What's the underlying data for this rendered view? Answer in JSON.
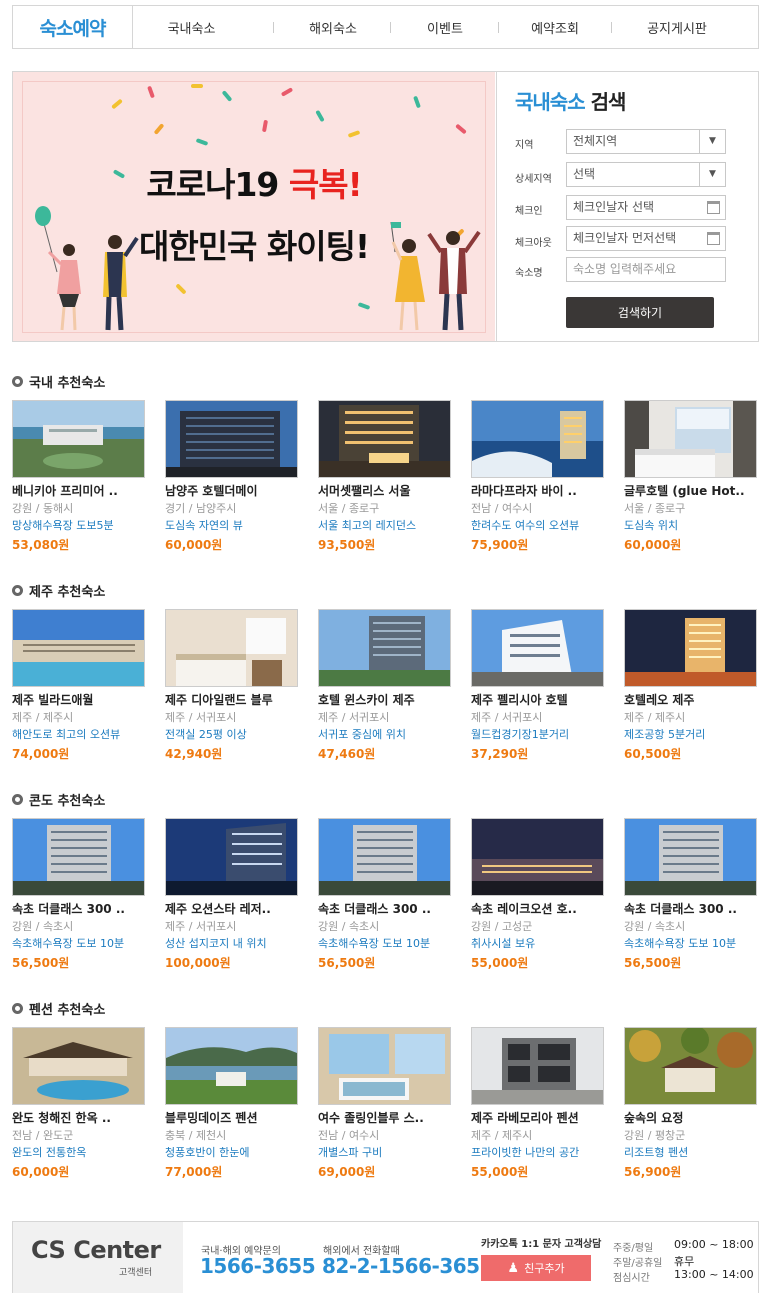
{
  "header": {
    "logo": "숙소예약",
    "nav": [
      "국내숙소",
      "해외숙소",
      "이벤트",
      "예약조회",
      "공지게시판"
    ]
  },
  "banner": {
    "line1_pre": "코로나19 ",
    "line1_highlight": "극복!",
    "line2": "대한민국 화이팅!"
  },
  "search": {
    "title_highlight": "국내숙소",
    "title_rest": " 검색",
    "fields": [
      {
        "label": "지역",
        "value": "전체지역"
      },
      {
        "label": "상세지역",
        "value": "선택"
      },
      {
        "label": "체크인",
        "value": "체크인날자 선택"
      },
      {
        "label": "체크아웃",
        "value": "체크인날자 먼저선택"
      },
      {
        "label": "숙소명",
        "placeholder": "숙소명 입력해주세요"
      }
    ],
    "button": "검색하기"
  },
  "sections": [
    {
      "title": "국내 추천숙소",
      "items": [
        {
          "name": "베니키아 프리미어 ..",
          "location": "강원 / 동해시",
          "desc": "망상해수욕장 도보5분",
          "price": "53,080원"
        },
        {
          "name": "남양주 호텔더메이",
          "location": "경기 / 남양주시",
          "desc": "도심속 자연의 뷰",
          "price": "60,000원"
        },
        {
          "name": "서머셋팰리스 서울",
          "location": "서울 / 종로구",
          "desc": "서울 최고의 레지던스",
          "price": "93,500원"
        },
        {
          "name": "라마다프라자 바이 ..",
          "location": "전남 / 여수시",
          "desc": "한려수도 여수의 오션뷰",
          "price": "75,900원"
        },
        {
          "name": "글루호텔 (glue Hot..",
          "location": "서울 / 종로구",
          "desc": "도심속 위치",
          "price": "60,000원"
        }
      ]
    },
    {
      "title": "제주 추천숙소",
      "items": [
        {
          "name": "제주 빌라드애월",
          "location": "제주 / 제주시",
          "desc": "해안도로 최고의 오션뷰",
          "price": "74,000원"
        },
        {
          "name": "제주 디아일랜드 블루",
          "location": "제주 / 서귀포시",
          "desc": "전객실 25평 이상",
          "price": "42,940원"
        },
        {
          "name": "호텔 윈스카이 제주",
          "location": "제주 / 서귀포시",
          "desc": "서귀포 중심에 위치",
          "price": "47,460원"
        },
        {
          "name": "제주 펠리시아 호텔",
          "location": "제주 / 서귀포시",
          "desc": "월드컵경기장1분거리",
          "price": "37,290원"
        },
        {
          "name": "호텔레오 제주",
          "location": "제주 / 제주시",
          "desc": "제조공항 5분거리",
          "price": "60,500원"
        }
      ]
    },
    {
      "title": "콘도 추천숙소",
      "items": [
        {
          "name": "속초 더클래스 300 ..",
          "location": "강원 / 속초시",
          "desc": "속초해수욕장 도보 10분",
          "price": "56,500원"
        },
        {
          "name": "제주 오션스타 레저..",
          "location": "제주 / 서귀포시",
          "desc": "성산 섭지코지 내 위치",
          "price": "100,000원"
        },
        {
          "name": "속초 더클래스 300 ..",
          "location": "강원 / 속초시",
          "desc": "속초해수욕장 도보 10분",
          "price": "56,500원"
        },
        {
          "name": "속초 레이크오션 호..",
          "location": "강원 / 고성군",
          "desc": "취사시설 보유",
          "price": "55,000원"
        },
        {
          "name": "속초 더클래스 300 ..",
          "location": "강원 / 속초시",
          "desc": "속초해수욕장 도보 10분",
          "price": "56,500원"
        }
      ]
    },
    {
      "title": "펜션 추천숙소",
      "items": [
        {
          "name": "완도 청해진 한옥 ..",
          "location": "전남 / 완도군",
          "desc": "완도의 전통한옥",
          "price": "60,000원"
        },
        {
          "name": "블루밍데이즈 펜션",
          "location": "충북 / 제천시",
          "desc": "청풍호반이 한눈에",
          "price": "77,000원"
        },
        {
          "name": "여수 졸링인블루 스..",
          "location": "전남 / 여수시",
          "desc": "개별스파 구비",
          "price": "69,000원"
        },
        {
          "name": "제주 라베모리아 펜션",
          "location": "제주 / 제주시",
          "desc": "프라이빗한 나만의 공간",
          "price": "55,000원"
        },
        {
          "name": "숲속의 요정",
          "location": "강원 / 평창군",
          "desc": "리조트형 펜션",
          "price": "56,900원"
        }
      ]
    }
  ],
  "footer": {
    "cs_title": "CS Center",
    "cs_sub": "고객센터",
    "phone1_label": "국내·해외 예약문의",
    "phone1": "1566-3655",
    "phone2_label": "해외에서 전화할때",
    "phone2": "82-2-1566-3655",
    "kakao_label": "카카오톡 1:1 문자 고객상담",
    "kakao_button": "친구추가",
    "hours": [
      {
        "label": "주중/평일",
        "value": "09:00 ~ 18:00"
      },
      {
        "label": "주말/공휴일",
        "value": "휴무"
      },
      {
        "label": "점심시간",
        "value": "13:00 ~ 14:00"
      }
    ]
  },
  "colors": {
    "accent": "#2a8fd4",
    "price": "#ee7a11",
    "desc": "#1c7bbf",
    "button": "#3a3736",
    "kakao": "#ef6b6b"
  }
}
